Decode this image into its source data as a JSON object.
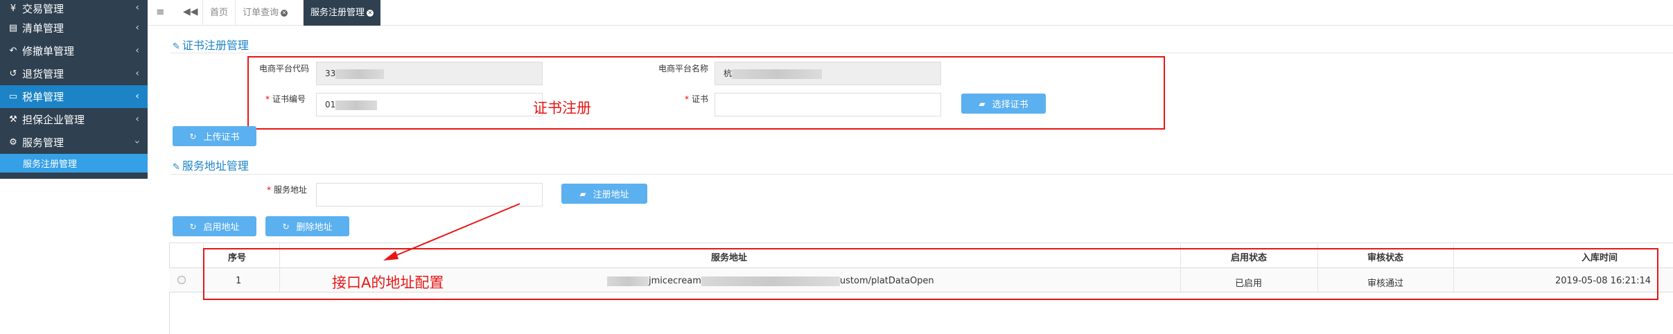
{
  "sidebar": {
    "items": [
      {
        "icon": "yen-icon",
        "glyph": "¥",
        "label": "交易管理"
      },
      {
        "icon": "file-icon",
        "glyph": "▤",
        "label": "清单管理"
      },
      {
        "icon": "undo-icon",
        "glyph": "↶",
        "label": "修撤单管理"
      },
      {
        "icon": "return-icon",
        "glyph": "↺",
        "label": "退货管理"
      },
      {
        "icon": "card-icon",
        "glyph": "▭",
        "label": "税单管理"
      },
      {
        "icon": "hammer-icon",
        "glyph": "⚒",
        "label": "担保企业管理"
      },
      {
        "icon": "gear-icon",
        "glyph": "⚙",
        "label": "服务管理"
      }
    ],
    "sub_item": "服务注册管理"
  },
  "tabs": [
    {
      "label": "首页"
    },
    {
      "label": "订单查询"
    },
    {
      "label": "服务注册管理"
    }
  ],
  "cert_section": {
    "title": "证书注册管理",
    "platform_code_label": "电商平台代码",
    "platform_code_value": "33",
    "platform_name_label": "电商平台名称",
    "platform_name_value": "杭",
    "cert_no_label": "证书编号",
    "cert_no_value": "01",
    "cert_label": "证书",
    "cert_value": "",
    "select_cert_button": "选择证书",
    "upload_cert_button": "上传证书",
    "annotation": "证书注册"
  },
  "service_section": {
    "title": "服务地址管理",
    "address_label": "服务地址",
    "address_value": "",
    "register_button": "注册地址",
    "enable_button": "启用地址",
    "delete_button": "删除地址",
    "annotation": "接口A的地址配置"
  },
  "table": {
    "headers": [
      "序号",
      "服务地址",
      "启用状态",
      "审核状态",
      "入库时间"
    ],
    "rows": [
      {
        "no": "1",
        "address_prefix": "jmicecream",
        "address_suffix": "ustom/platDataOpen",
        "enable_status": "已启用",
        "audit_status": "审核通过",
        "time": "2019-05-08 16:21:14"
      }
    ]
  },
  "colors": {
    "accent": "#1c84c6",
    "annotation_red": "#e81515",
    "sidebar_bg": "#2f4050",
    "button_blue": "#5bb0ef"
  }
}
